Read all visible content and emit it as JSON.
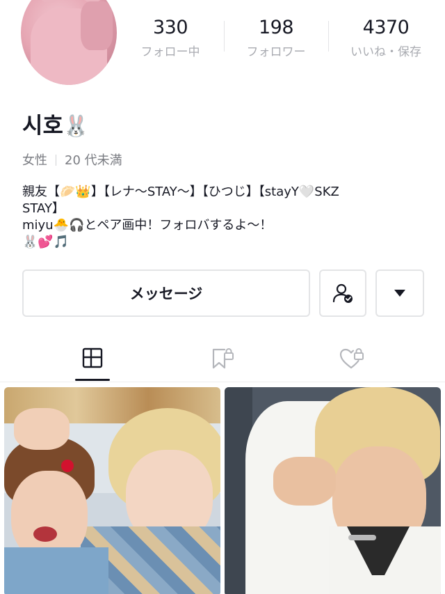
{
  "profile": {
    "name": "시호",
    "name_emoji": "🐰",
    "meta_gender": "女性",
    "meta_age": "20 代未満",
    "bio_lines": [
      "親友【🥟👑】【レナ〜STAY〜】【ひつじ】【stayY🤍SKZ",
      "STAY】",
      "miyu🐣🎧とペア画中！フォロバするよ〜！",
      "🐰💕🎵"
    ]
  },
  "stats": {
    "following": {
      "count": "330",
      "label": "フォロー中"
    },
    "followers": {
      "count": "198",
      "label": "フォロワー"
    },
    "likes": {
      "count": "4370",
      "label": "いいね・保存"
    }
  },
  "actions": {
    "message_label": "メッセージ",
    "follow_icon": "user-check-icon",
    "more_icon": "caret-down-icon"
  },
  "tabs": [
    {
      "icon": "grid-icon",
      "active": true
    },
    {
      "icon": "bookmark-lock-icon",
      "active": false
    },
    {
      "icon": "heart-lock-icon",
      "active": false
    }
  ],
  "colors": {
    "text": "#161823",
    "muted": "#a9abb1",
    "border": "#e3e4e6"
  }
}
